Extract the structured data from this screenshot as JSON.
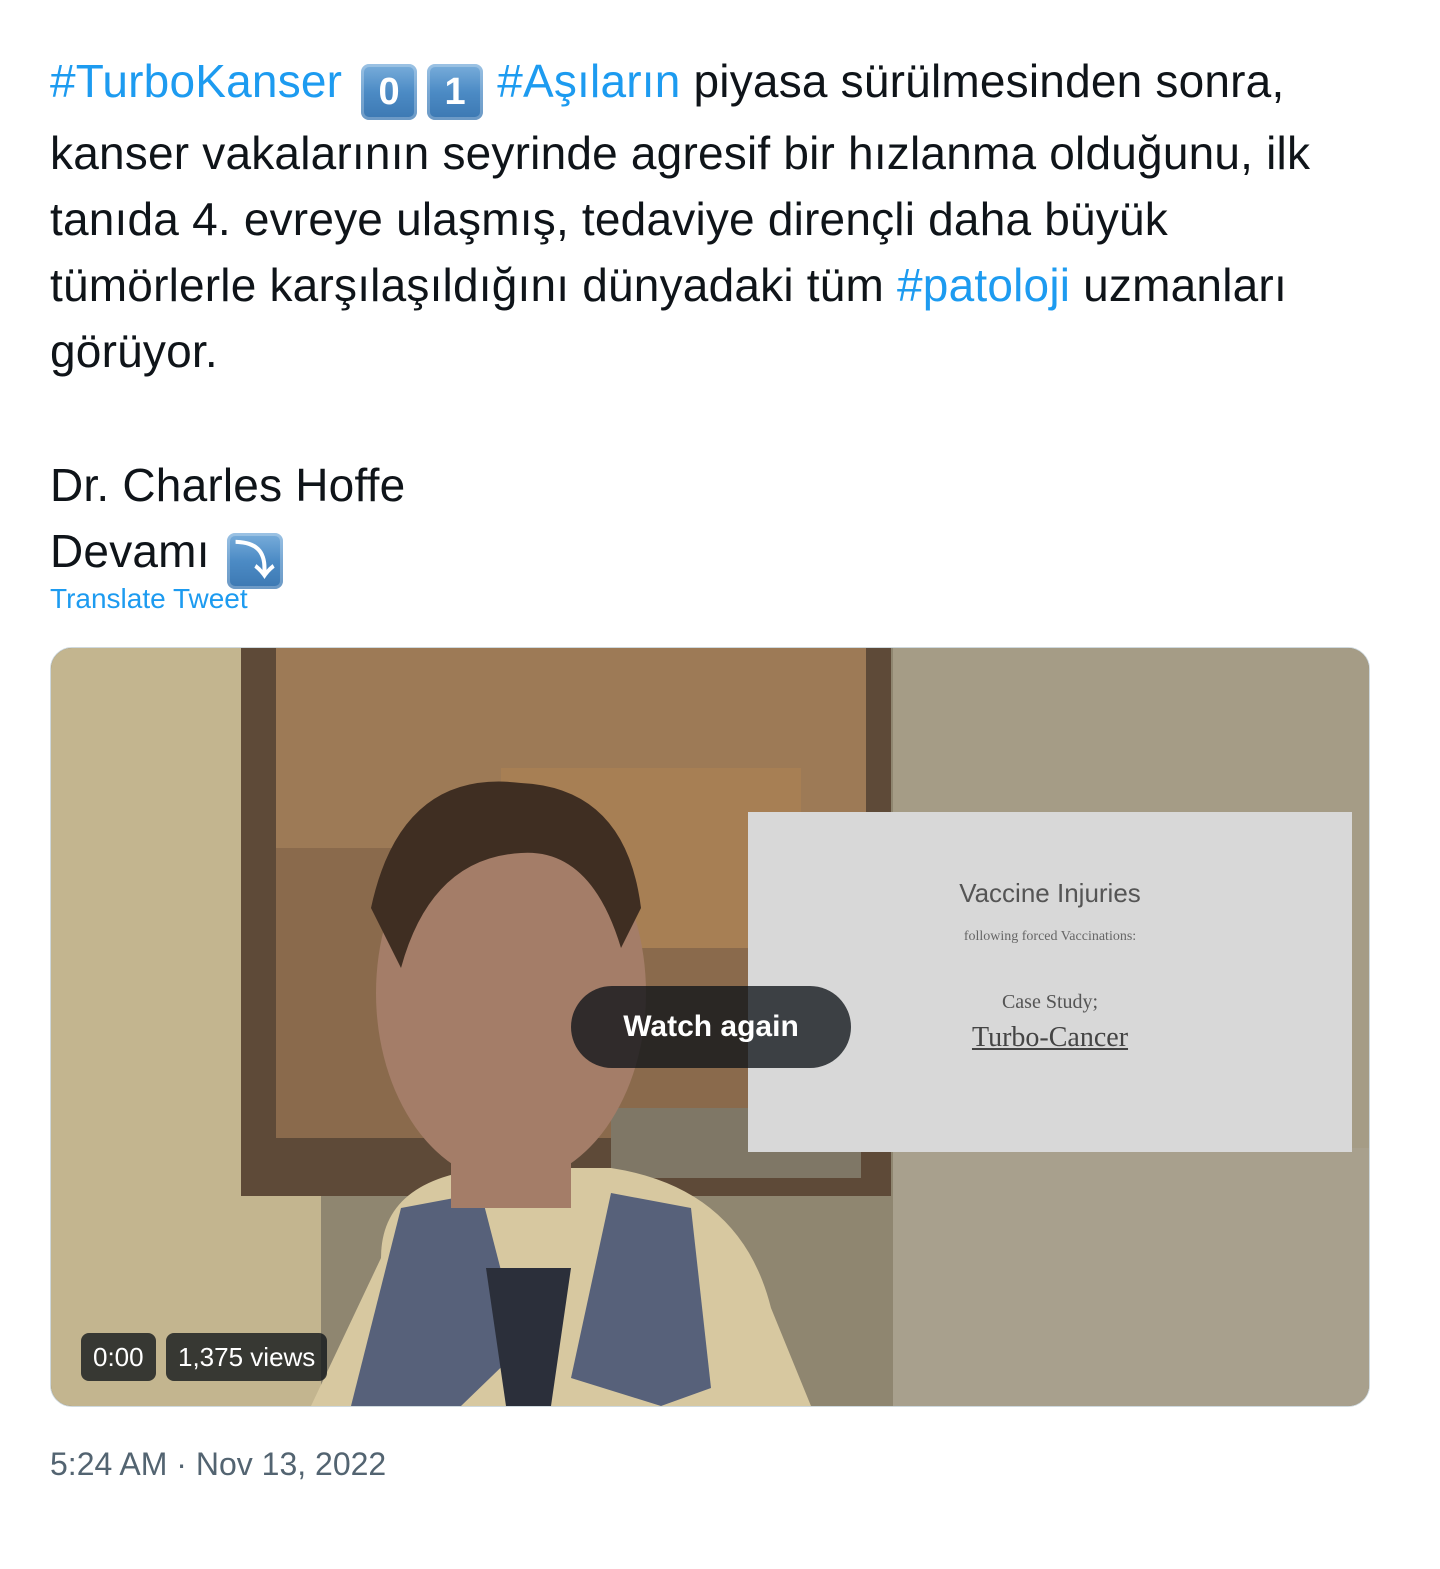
{
  "tweet": {
    "hashtag_1": "#TurboKanser",
    "keycap_1": "0",
    "keycap_2": "1",
    "hashtag_2": "#Aşıların",
    "text_1": " piyasa sürülmesinden sonra, kanser vakalarının seyrinde agresif bir hızlanma olduğunu, ilk tanıda 4. evreye ulaşmış, tedaviye dirençli daha büyük tümörlerle karşılaşıldığını dünyadaki tüm ",
    "hashtag_3": "#patoloji",
    "text_2": " uzmanları görüyor.",
    "author_line": "Dr. Charles Hoffe",
    "more_label": "Devamı",
    "more_icon": "⤵",
    "translate_label": "Translate Tweet",
    "timestamp": "5:24 AM · Nov 13, 2022"
  },
  "video": {
    "slide_title": "Vaccine Injuries",
    "slide_subtitle": "following forced Vaccinations:",
    "slide_case": "Case Study;",
    "slide_topic": "Turbo-Cancer",
    "watch_again_label": "Watch again",
    "time": "0:00",
    "views": "1,375 views"
  },
  "colors": {
    "hashtag": "#1d9bf0",
    "text": "#0f1419",
    "muted": "#536471"
  }
}
